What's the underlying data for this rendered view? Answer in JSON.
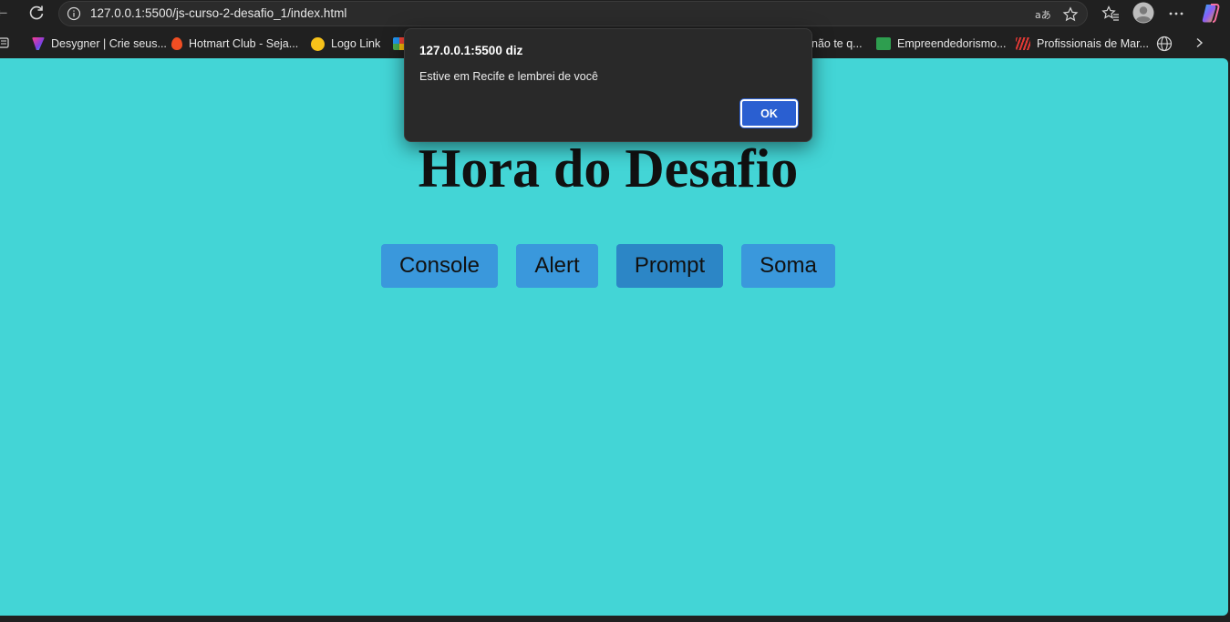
{
  "browser": {
    "url": "127.0.0.1:5500/js-curso-2-desafio_1/index.html",
    "bookmarks": [
      {
        "label": "Desygner | Crie seus...",
        "color": "#7b3fe4"
      },
      {
        "label": "Hotmart Club - Seja...",
        "color": "#f04e23"
      },
      {
        "label": "Logo Link",
        "color": "#f7c21a"
      },
      {
        "label": "não te q...",
        "color": "#888888"
      },
      {
        "label": "Empreendedorismo...",
        "color": "#2e9e4f"
      },
      {
        "label": "Profissionais de Mar...",
        "color": "#e53935"
      }
    ]
  },
  "dialog": {
    "title": "127.0.0.1:5500 diz",
    "message": "Estive em Recife e lembrei de você",
    "ok_label": "OK"
  },
  "page": {
    "title": "Hora do Desafio",
    "background": "#43d5d6",
    "button_color": "#3a98dc",
    "buttons": [
      {
        "label": "Console"
      },
      {
        "label": "Alert"
      },
      {
        "label": "Prompt"
      },
      {
        "label": "Soma"
      }
    ]
  }
}
